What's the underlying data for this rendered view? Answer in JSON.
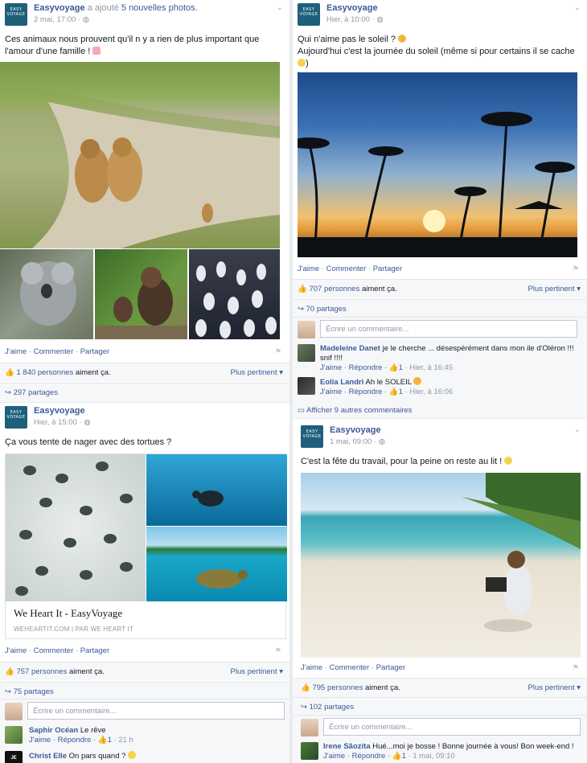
{
  "colors": {
    "link": "#3b5998",
    "muted": "#9197a3",
    "brand": "#1e5f7a"
  },
  "page_name": "Easyvoyage",
  "logo_text": "EASY VOYAGE",
  "post1": {
    "author": "Easyvoyage",
    "action": "a ajouté",
    "action_link": "5 nouvelles photos.",
    "time": "2 mai, 17:00 ·",
    "text": "Ces animaux nous prouvent qu'il n y a rien de plus important que l'amour d'une famille !",
    "actions": [
      "J'aime",
      "Commenter",
      "Partager"
    ],
    "likes_count": "1 840 personnes",
    "likes_suffix": "aiment ça.",
    "sort": "Plus pertinent ▾",
    "shares": "297 partages"
  },
  "post2": {
    "author": "Easyvoyage",
    "time": "Hier, à 10:00 ·",
    "text_line1": "Qui n'aime pas le soleil ?",
    "text_line2": "Aujourd'hui c'est la journée du soleil (même si pour certains il se cache",
    "text_line3": "!",
    "actions": [
      "J'aime",
      "Commenter",
      "Partager"
    ],
    "likes_count": "707 personnes",
    "likes_suffix": "aiment ça.",
    "sort": "Plus pertinent ▾",
    "shares": "70 partages",
    "comment_placeholder": "Écrire un commentaire...",
    "comments": [
      {
        "name": "Madeleine Danet",
        "text": "je le cherche ... désespérément dans mon ile d'Oléron !!! snif !!!!",
        "reply": "J'aime · Répondre ·",
        "likes": "1",
        "time": "· Hier, à 16:45"
      },
      {
        "name": "Eolia Landri",
        "text": "Ah le SOLEIL",
        "reply": "J'aime · Répondre ·",
        "likes": "1",
        "time": "· Hier, à 16:06"
      }
    ],
    "more_comments": "Afficher 9 autres commentaires"
  },
  "post3": {
    "author": "Easyvoyage",
    "time": "Hier, à 15:00 ·",
    "text": "Ça vous tente de nager avec des tortues ?",
    "link_title": "We Heart It - EasyVoyage",
    "link_source": "WEHEARTIT.COM | PAR WE HEART IT",
    "actions": [
      "J'aime",
      "Commenter",
      "Partager"
    ],
    "likes_count": "757 personnes",
    "likes_suffix": "aiment ça.",
    "sort": "Plus pertinent ▾",
    "shares": "75 partages",
    "comment_placeholder": "Écrire un commentaire...",
    "comments": [
      {
        "name": "Saphir Océan",
        "text": "Le rêve",
        "reply": "J'aime · Répondre ·",
        "likes": "1",
        "time": "· 21 h"
      },
      {
        "name": "Christ Elle",
        "text": "On pars quand ?",
        "reply": "",
        "likes": "",
        "time": ""
      }
    ],
    "je_suis_badge": "JE SUIS"
  },
  "post4": {
    "author": "Easyvoyage",
    "time": "1 mai, 09:00 ·",
    "text": "C'est la fête du travail, pour la peine on reste au lit !",
    "actions": [
      "J'aime",
      "Commenter",
      "Partager"
    ],
    "likes_count": "795 personnes",
    "likes_suffix": "aiment ça.",
    "sort": "Plus pertinent ▾",
    "shares": "102 partages",
    "comment_placeholder": "Écrire un commentaire...",
    "comments": [
      {
        "name": "Irene Sãozita",
        "text": "Hué...moi je bosse ! Bonne journée à vous! Bon week-end !",
        "reply": "J'aime · Répondre ·",
        "likes": "1",
        "time": "· 1 mai, 09:10"
      }
    ]
  }
}
